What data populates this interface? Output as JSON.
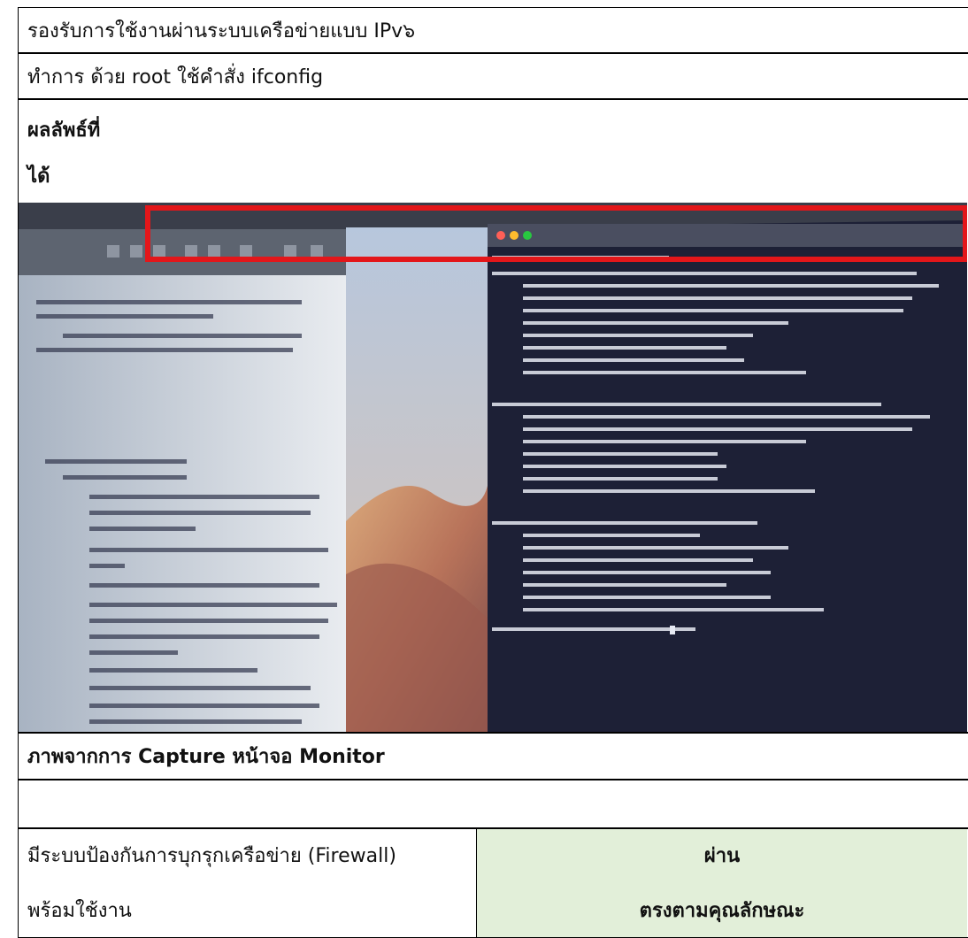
{
  "rows": {
    "ipv6_support": "รองรับการใช้งานผ่านระบบเครือข่ายแบบ IPv๖",
    "command_line": "ทำการ ด้วย root   ใช้คำสั่ง ifconfig",
    "result_label_line1": "ผลลัพธ์ที่",
    "result_label_line2": "ได้",
    "capture_caption": "ภาพจากการ  Capture   หน้าจอ Monitor",
    "empty_row": ""
  },
  "firewall": {
    "requirement_line1": "มีระบบป้องกันการบุกรุกเครือข่าย (Firewall)",
    "requirement_line2": "พร้อมใช้งาน",
    "status_line1": "ผ่าน",
    "status_line2": "ตรงตามคุณลักษณะ"
  },
  "photo": {
    "icon": "photo-of-monitor",
    "highlight_color": "#e3161a",
    "status_color": "#e2efd9"
  }
}
